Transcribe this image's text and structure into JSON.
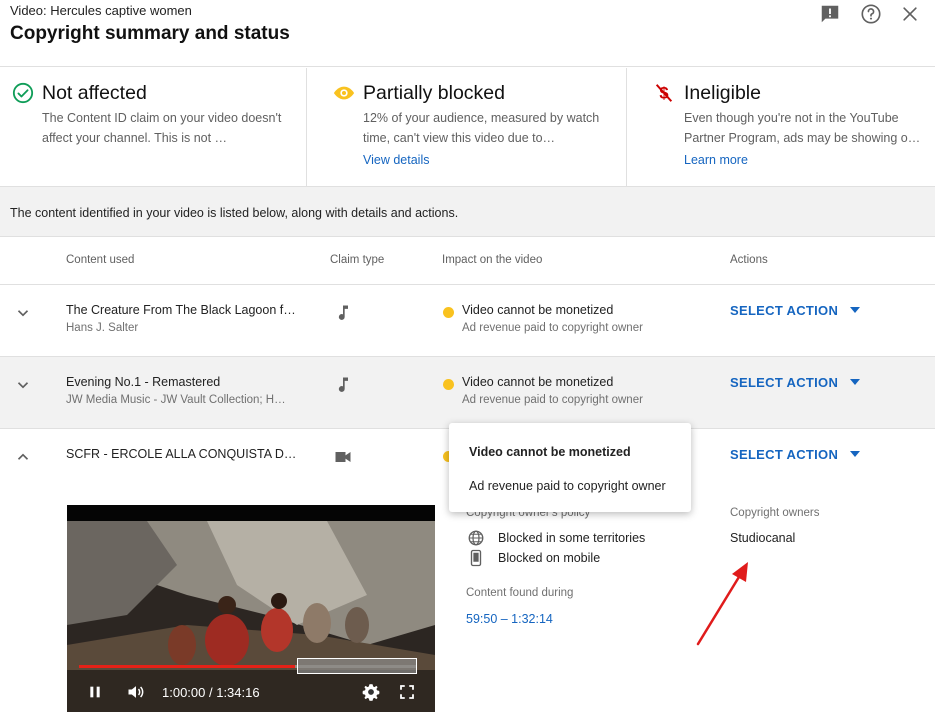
{
  "header": {
    "video_title": "Video: Hercules captive women",
    "dialog_title": "Copyright summary and status",
    "icons": [
      "feedback-icon",
      "help-icon",
      "close-icon"
    ]
  },
  "cards": [
    {
      "icon": "check-circle-icon",
      "title": "Not affected",
      "text": "The Content ID claim on your video doesn't affect your channel. This is not …",
      "link": ""
    },
    {
      "icon": "eye-icon",
      "title": "Partially blocked",
      "text": "12% of your audience, measured by watch time, can't view this video due to…",
      "link": "View details"
    },
    {
      "icon": "no-money-icon",
      "title": "Ineligible",
      "text": "Even though you're not in the YouTube Partner Program, ads may be showing o…",
      "link": "Learn more"
    }
  ],
  "info_text": "The content identified in your video is listed below, along with details and actions.",
  "table": {
    "headers": [
      "Content used",
      "Claim type",
      "Impact on the video",
      "Actions"
    ],
    "rows": [
      {
        "title": "The Creature From The Black Lagoon f…",
        "subtitle": "Hans J. Salter",
        "claim_icon": "music-note-icon",
        "impact_title": "Video cannot be monetized",
        "impact_sub": "Ad revenue paid to copyright owner",
        "action": "SELECT ACTION",
        "expanded": false
      },
      {
        "title": "Evening No.1 - Remastered",
        "subtitle": "JW Media Music - JW Vault Collection; H…",
        "claim_icon": "music-note-icon",
        "impact_title": "Video cannot be monetized",
        "impact_sub": "Ad revenue paid to copyright owner",
        "action": "SELECT ACTION",
        "expanded": false
      },
      {
        "title": "SCFR - ERCOLE ALLA CONQUISTA DA…",
        "subtitle": "",
        "claim_icon": "videocam-icon",
        "impact_title": "",
        "impact_sub": "",
        "action": "SELECT ACTION",
        "expanded": true
      }
    ]
  },
  "details": {
    "policy_label": "Copyright owner's policy",
    "policy_items": [
      "Blocked in some territories",
      "Blocked on mobile"
    ],
    "found_label": "Content found during",
    "found_value": "59:50 – 1:32:14",
    "owners_label": "Copyright owners",
    "owners_value": "Studiocanal"
  },
  "player": {
    "time": "1:00:00 / 1:34:16",
    "progress": 0.64
  },
  "tooltip": {
    "title": "Video cannot be monetized",
    "text": "Ad revenue paid to copyright owner"
  },
  "colors": {
    "link": "#1565c0",
    "warning_dot": "#f9c21f",
    "check_green": "#0f9d58",
    "money_red": "#cc0000",
    "progress_red": "#e62117",
    "annotation_red": "#e01b1b"
  }
}
